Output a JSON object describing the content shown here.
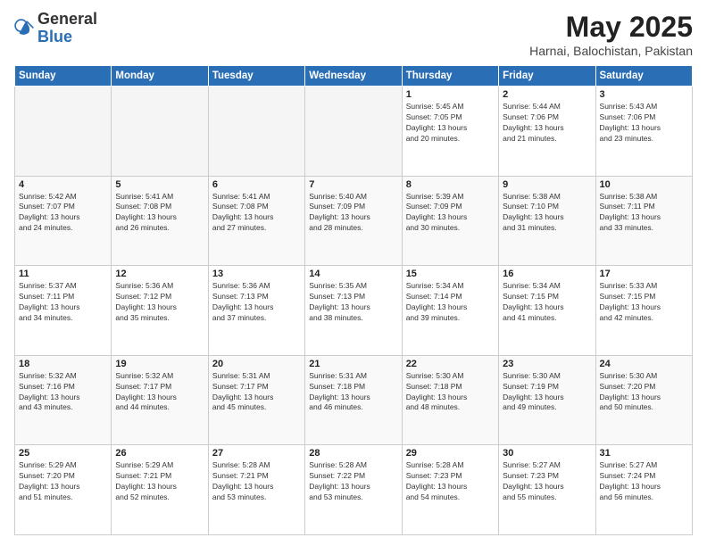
{
  "logo": {
    "general": "General",
    "blue": "Blue"
  },
  "header": {
    "month": "May 2025",
    "location": "Harnai, Balochistan, Pakistan"
  },
  "days_of_week": [
    "Sunday",
    "Monday",
    "Tuesday",
    "Wednesday",
    "Thursday",
    "Friday",
    "Saturday"
  ],
  "weeks": [
    [
      {
        "day": "",
        "info": ""
      },
      {
        "day": "",
        "info": ""
      },
      {
        "day": "",
        "info": ""
      },
      {
        "day": "",
        "info": ""
      },
      {
        "day": "1",
        "info": "Sunrise: 5:45 AM\nSunset: 7:05 PM\nDaylight: 13 hours\nand 20 minutes."
      },
      {
        "day": "2",
        "info": "Sunrise: 5:44 AM\nSunset: 7:06 PM\nDaylight: 13 hours\nand 21 minutes."
      },
      {
        "day": "3",
        "info": "Sunrise: 5:43 AM\nSunset: 7:06 PM\nDaylight: 13 hours\nand 23 minutes."
      }
    ],
    [
      {
        "day": "4",
        "info": "Sunrise: 5:42 AM\nSunset: 7:07 PM\nDaylight: 13 hours\nand 24 minutes."
      },
      {
        "day": "5",
        "info": "Sunrise: 5:41 AM\nSunset: 7:08 PM\nDaylight: 13 hours\nand 26 minutes."
      },
      {
        "day": "6",
        "info": "Sunrise: 5:41 AM\nSunset: 7:08 PM\nDaylight: 13 hours\nand 27 minutes."
      },
      {
        "day": "7",
        "info": "Sunrise: 5:40 AM\nSunset: 7:09 PM\nDaylight: 13 hours\nand 28 minutes."
      },
      {
        "day": "8",
        "info": "Sunrise: 5:39 AM\nSunset: 7:09 PM\nDaylight: 13 hours\nand 30 minutes."
      },
      {
        "day": "9",
        "info": "Sunrise: 5:38 AM\nSunset: 7:10 PM\nDaylight: 13 hours\nand 31 minutes."
      },
      {
        "day": "10",
        "info": "Sunrise: 5:38 AM\nSunset: 7:11 PM\nDaylight: 13 hours\nand 33 minutes."
      }
    ],
    [
      {
        "day": "11",
        "info": "Sunrise: 5:37 AM\nSunset: 7:11 PM\nDaylight: 13 hours\nand 34 minutes."
      },
      {
        "day": "12",
        "info": "Sunrise: 5:36 AM\nSunset: 7:12 PM\nDaylight: 13 hours\nand 35 minutes."
      },
      {
        "day": "13",
        "info": "Sunrise: 5:36 AM\nSunset: 7:13 PM\nDaylight: 13 hours\nand 37 minutes."
      },
      {
        "day": "14",
        "info": "Sunrise: 5:35 AM\nSunset: 7:13 PM\nDaylight: 13 hours\nand 38 minutes."
      },
      {
        "day": "15",
        "info": "Sunrise: 5:34 AM\nSunset: 7:14 PM\nDaylight: 13 hours\nand 39 minutes."
      },
      {
        "day": "16",
        "info": "Sunrise: 5:34 AM\nSunset: 7:15 PM\nDaylight: 13 hours\nand 41 minutes."
      },
      {
        "day": "17",
        "info": "Sunrise: 5:33 AM\nSunset: 7:15 PM\nDaylight: 13 hours\nand 42 minutes."
      }
    ],
    [
      {
        "day": "18",
        "info": "Sunrise: 5:32 AM\nSunset: 7:16 PM\nDaylight: 13 hours\nand 43 minutes."
      },
      {
        "day": "19",
        "info": "Sunrise: 5:32 AM\nSunset: 7:17 PM\nDaylight: 13 hours\nand 44 minutes."
      },
      {
        "day": "20",
        "info": "Sunrise: 5:31 AM\nSunset: 7:17 PM\nDaylight: 13 hours\nand 45 minutes."
      },
      {
        "day": "21",
        "info": "Sunrise: 5:31 AM\nSunset: 7:18 PM\nDaylight: 13 hours\nand 46 minutes."
      },
      {
        "day": "22",
        "info": "Sunrise: 5:30 AM\nSunset: 7:18 PM\nDaylight: 13 hours\nand 48 minutes."
      },
      {
        "day": "23",
        "info": "Sunrise: 5:30 AM\nSunset: 7:19 PM\nDaylight: 13 hours\nand 49 minutes."
      },
      {
        "day": "24",
        "info": "Sunrise: 5:30 AM\nSunset: 7:20 PM\nDaylight: 13 hours\nand 50 minutes."
      }
    ],
    [
      {
        "day": "25",
        "info": "Sunrise: 5:29 AM\nSunset: 7:20 PM\nDaylight: 13 hours\nand 51 minutes."
      },
      {
        "day": "26",
        "info": "Sunrise: 5:29 AM\nSunset: 7:21 PM\nDaylight: 13 hours\nand 52 minutes."
      },
      {
        "day": "27",
        "info": "Sunrise: 5:28 AM\nSunset: 7:21 PM\nDaylight: 13 hours\nand 53 minutes."
      },
      {
        "day": "28",
        "info": "Sunrise: 5:28 AM\nSunset: 7:22 PM\nDaylight: 13 hours\nand 53 minutes."
      },
      {
        "day": "29",
        "info": "Sunrise: 5:28 AM\nSunset: 7:23 PM\nDaylight: 13 hours\nand 54 minutes."
      },
      {
        "day": "30",
        "info": "Sunrise: 5:27 AM\nSunset: 7:23 PM\nDaylight: 13 hours\nand 55 minutes."
      },
      {
        "day": "31",
        "info": "Sunrise: 5:27 AM\nSunset: 7:24 PM\nDaylight: 13 hours\nand 56 minutes."
      }
    ]
  ]
}
